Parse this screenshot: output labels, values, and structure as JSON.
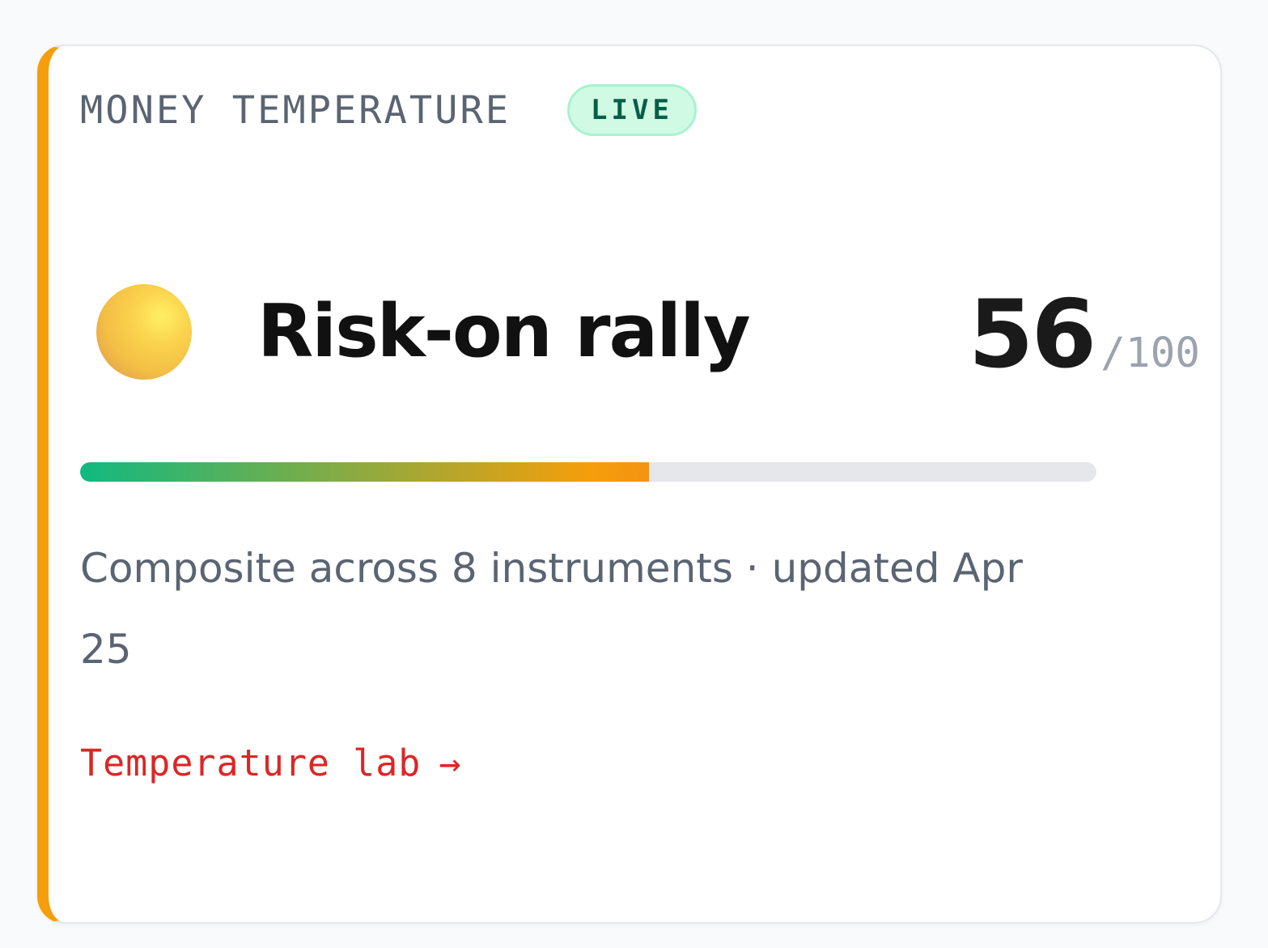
{
  "card": {
    "eyebrow": "MONEY TEMPERATURE",
    "badge": "LIVE",
    "status_icon": "orb-icon",
    "status_title": "Risk-on rally",
    "score": "56",
    "score_max": "/100",
    "progress_fraction": 0.56,
    "description": "Composite across 8 instruments · updated Apr 25",
    "cta_label": "Temperature lab",
    "cta_icon": "arrow-right-icon",
    "cta_arrow": "→"
  },
  "colors": {
    "accent_bar": "#f59e0b",
    "live_badge_bg": "#d1fae5",
    "live_badge_text": "#065f46",
    "gradient_start": "#10b981",
    "gradient_mid": "#f59e0b",
    "gradient_end": "#ef4444",
    "track": "#e5e7eb",
    "cta_text": "#dc2626",
    "orb": "#f3bf45"
  }
}
